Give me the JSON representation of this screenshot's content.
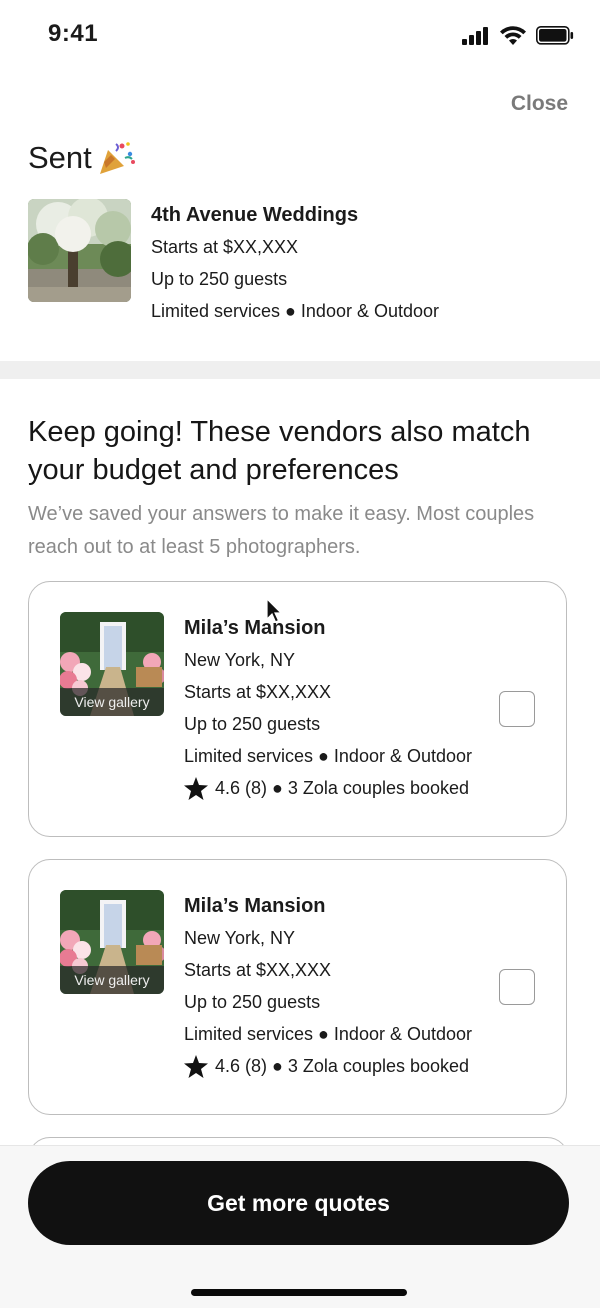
{
  "status_bar": {
    "time": "9:41"
  },
  "header": {
    "close_label": "Close"
  },
  "sent": {
    "title": "Sent",
    "vendor": {
      "name": "4th Avenue Weddings",
      "price": "Starts at $XX,XXX",
      "guests": "Up to 250 guests",
      "services": "Limited services ● Indoor & Outdoor"
    }
  },
  "recommendations": {
    "headline": "Keep going! These vendors also match your budget and preferences",
    "subtext": "We’ve saved your answers to make it easy. Most couples reach out to at least 5 photographers.",
    "cards": [
      {
        "gallery_label": "View gallery",
        "name": "Mila’s Mansion",
        "location": "New York, NY",
        "price": "Starts at $XX,XXX",
        "guests": "Up to 250 guests",
        "services": "Limited services ● Indoor & Outdoor",
        "rating": "4.6 (8) ● 3 Zola couples booked"
      },
      {
        "gallery_label": "View gallery",
        "name": "Mila’s Mansion",
        "location": "New York, NY",
        "price": "Starts at $XX,XXX",
        "guests": "Up to 250 guests",
        "services": "Limited services ● Indoor & Outdoor",
        "rating": "4.6 (8) ● 3 Zola couples booked"
      }
    ]
  },
  "footer": {
    "cta_label": "Get more quotes"
  }
}
